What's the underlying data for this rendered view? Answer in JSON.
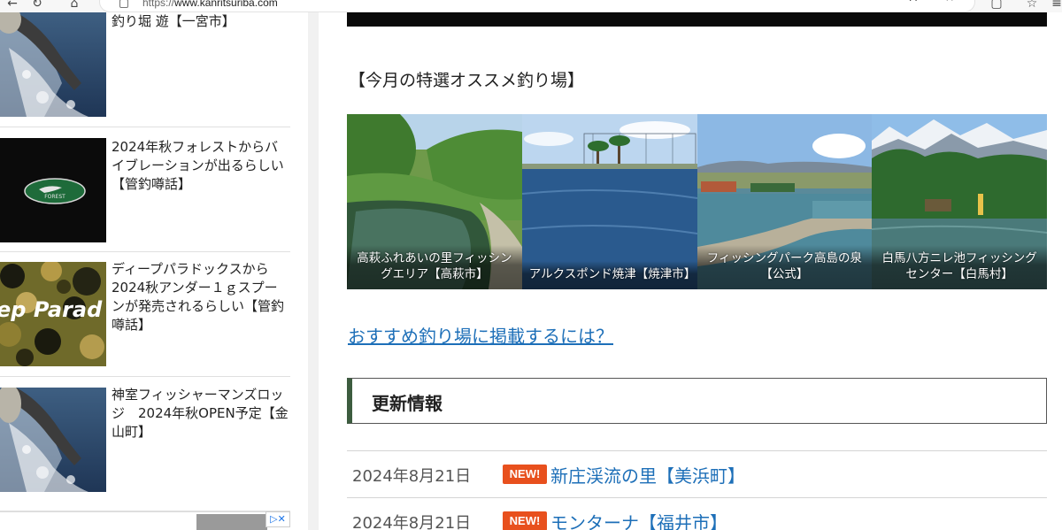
{
  "browser": {
    "url_scheme": "https://",
    "url_host": "www.kanritsuriba.com",
    "reader_icon": "A⁺"
  },
  "sidebar": {
    "items": [
      {
        "title": "釣り堀 遊【一宮市】",
        "thumb": "fish-splash"
      },
      {
        "title": "2024年秋フォレストからバイブレーションが出るらしい【管釣噂話】",
        "thumb": "forest-logo",
        "logo_text": "FOREST"
      },
      {
        "title": "ディープパラドックスから2024秋アンダー１ｇスプーンが発売されるらしい【管釣噂話】",
        "thumb": "camo",
        "camo_text": "ep Parad"
      },
      {
        "title": "神室フィッシャーマンズロッジ　2024年秋OPEN予定【金山町】",
        "thumb": "fish-splash"
      }
    ]
  },
  "main": {
    "featured_heading": "【今月の特選オススメ釣り場】",
    "spots": [
      {
        "label": "高萩ふれあいの里フィッシングエリア【高萩市】"
      },
      {
        "label": "アルクスポンド焼津【焼津市】"
      },
      {
        "label": "フィッシングパーク高島の泉【公式】"
      },
      {
        "label": "白馬八方ニレ池フィッシングセンター【白馬村】"
      }
    ],
    "recommend_link": "おすすめ釣り場に掲載するには？",
    "update_title": "更新情報",
    "news": [
      {
        "date": "2024年8月21日",
        "badge": "NEW!",
        "title": "新庄渓流の里【美浜町】"
      },
      {
        "date": "2024年8月21日",
        "badge": "NEW!",
        "title": "モンターナ【福井市】"
      }
    ]
  },
  "colors": {
    "link": "#1d6fb8",
    "badge": "#e8501d",
    "update_accent": "#3d5c3f"
  }
}
